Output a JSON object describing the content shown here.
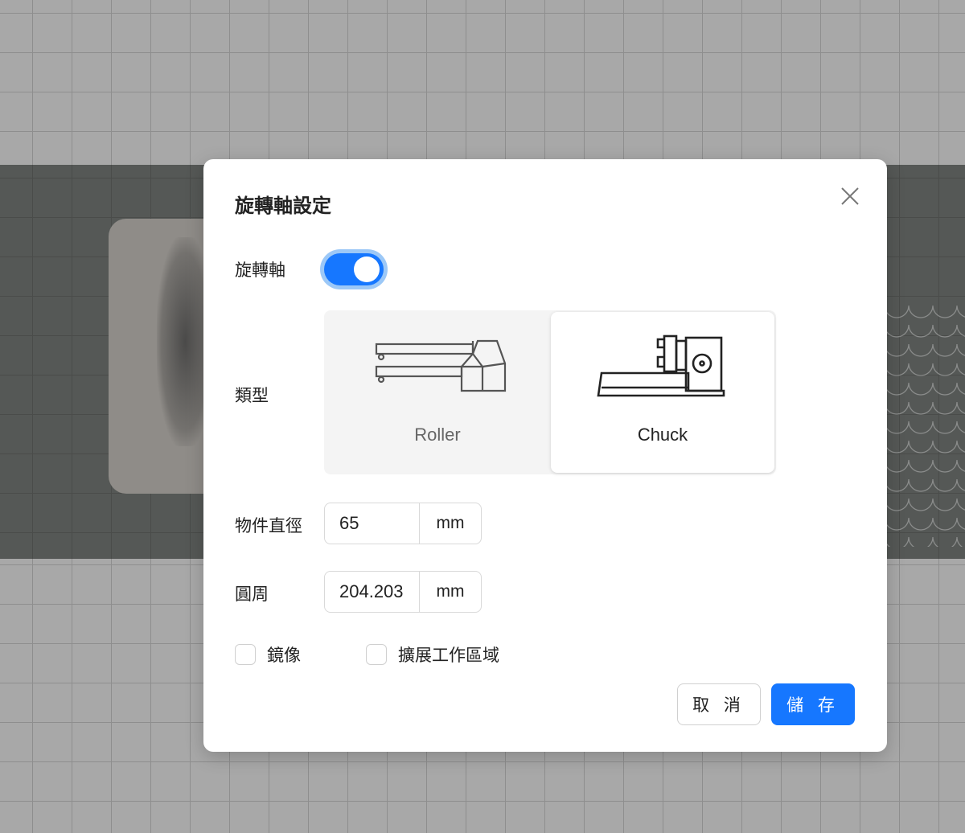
{
  "dialog": {
    "title": "旋轉軸設定",
    "rotary_label": "旋轉軸",
    "rotary_enabled": true,
    "type_label": "類型",
    "types": [
      {
        "label": "Roller",
        "selected": false
      },
      {
        "label": "Chuck",
        "selected": true
      }
    ],
    "diameter_label": "物件直徑",
    "diameter_value": "65",
    "diameter_unit": "mm",
    "circumference_label": "圓周",
    "circumference_value": "204.203",
    "circumference_unit": "mm",
    "mirror_label": "鏡像",
    "extend_label": "擴展工作區域",
    "cancel_label": "取 消",
    "save_label": "儲 存"
  },
  "colors": {
    "accent": "#1677ff"
  }
}
